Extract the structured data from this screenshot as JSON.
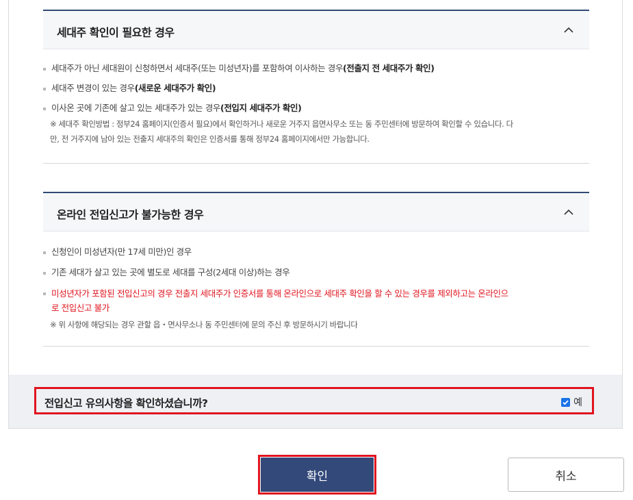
{
  "section1": {
    "title": "세대주 확인이 필요한 경우",
    "items": [
      {
        "text": "세대주가 아닌 세대원이 신청하면서 세대주(또는 미성년자)를 포함하여 이사하는 경우",
        "bold": "(전출지 전 세대주가 확인)"
      },
      {
        "text": "세대주 변경이 있는 경우",
        "bold": "(새로운 세대주가 확인)"
      },
      {
        "text": "이사온 곳에 기존에 살고 있는 세대주가 있는 경우",
        "bold": "(전입지 세대주가 확인)"
      }
    ],
    "note_line1": "※ 세대주 확인방법 : 정부24 홈페이지(인증서 필요)에서 확인하거나 새로운 거주지 읍면사무소 또는 동 주민센터에 방문하여 확인할 수 있습니다. 다",
    "note_line2": "만, 전 거주지에 남아 있는 전출지 세대주의 확인은 인증서를 통해 정부24 홈페이지에서만 가능합니다."
  },
  "section2": {
    "title": "온라인 전입신고가 불가능한 경우",
    "items": [
      "신청인이 미성년자(만 17세 미만)인 경우",
      "기존 세대가 살고 있는 곳에 별도로 세대를 구성(2세대 이상)하는 경우"
    ],
    "red_line1": "미성년자가 포함된 전입신고의 경우 전출지 세대주가 인증서를 통해 온라인으로 세대주 확인을 할 수 있는 경우를 제외하고는 온라인으",
    "red_line2": "로 전입신고 불가",
    "note": "※ 위 사항에 해당되는 경우 관할 읍・면사무소나 동 주민센터에 문의 주신 후 방문하시기 바랍니다"
  },
  "confirm": {
    "question": "전입신고 유의사항을 확인하셨습니까?",
    "checkbox_label": "예",
    "checked": true
  },
  "buttons": {
    "confirm": "확인",
    "cancel": "취소"
  },
  "colors": {
    "accent_navy": "#33497a",
    "highlight_red": "#e0141e",
    "checkbox_blue": "#1a73e8"
  },
  "icons": {
    "accordion_toggle": "chevron-up-icon",
    "checkbox": "check-icon"
  }
}
